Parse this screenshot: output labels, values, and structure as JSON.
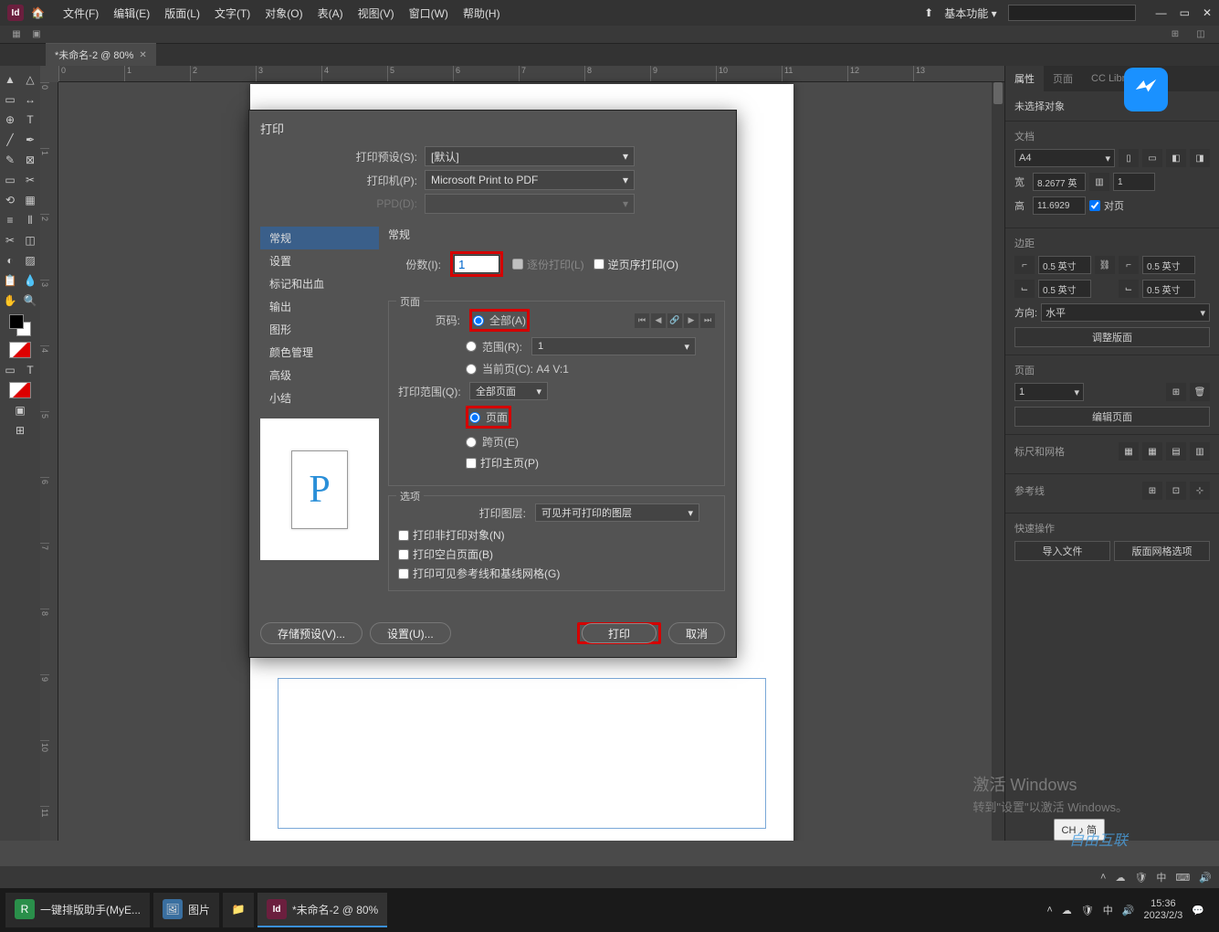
{
  "menubar": {
    "app": "Id",
    "items": [
      "文件(F)",
      "编辑(E)",
      "版面(L)",
      "文字(T)",
      "对象(O)",
      "表(A)",
      "视图(V)",
      "窗口(W)",
      "帮助(H)"
    ],
    "workspace": "基本功能"
  },
  "tab": {
    "name": "*未命名-2 @ 80%"
  },
  "ruler": {
    "ticks": [
      "0",
      "1",
      "2",
      "3",
      "4",
      "5",
      "6",
      "7",
      "8",
      "9",
      "10",
      "11",
      "12",
      "13"
    ]
  },
  "rightpanel": {
    "tabs": [
      "属性",
      "页面",
      "CC Libraries"
    ],
    "noSelection": "未选择对象",
    "doc": {
      "title": "文档",
      "preset": "A4",
      "wLabel": "宽",
      "w": "8.2677 英",
      "hLabel": "高",
      "h": "11.6929",
      "numPages": "1",
      "facingPages": "对页"
    },
    "margins": {
      "title": "边距",
      "top": "0.5 英寸",
      "bottom": "0.5 英寸",
      "left": "0.5 英寸",
      "right": "0.5 英寸"
    },
    "orientation": {
      "label": "方向:",
      "value": "水平"
    },
    "adjustLayout": "调整版面",
    "page": {
      "title": "页面",
      "num": "1",
      "editBtn": "编辑页面"
    },
    "rulers": {
      "title": "标尺和网格"
    },
    "guides": {
      "title": "参考线"
    },
    "quick": {
      "title": "快速操作",
      "import": "导入文件",
      "grid": "版面网格选项"
    }
  },
  "dialog": {
    "title": "打印",
    "preset": {
      "label": "打印预设(S):",
      "value": "[默认]"
    },
    "printer": {
      "label": "打印机(P):",
      "value": "Microsoft Print to PDF"
    },
    "ppd": {
      "label": "PPD(D):"
    },
    "sidebar": [
      "常规",
      "设置",
      "标记和出血",
      "输出",
      "图形",
      "颜色管理",
      "高级",
      "小结"
    ],
    "content": {
      "title": "常规",
      "copies": {
        "label": "份数(I):",
        "value": "1",
        "collate": "逐份打印(L)",
        "reverse": "逆页序打印(O)"
      },
      "pagesGroup": {
        "title": "页面",
        "pageNumLabel": "页码:",
        "all": "全部(A)",
        "rangeLabel": "范围(R):",
        "rangeValue": "1",
        "current": "当前页(C):   A4 V:1",
        "printRangeLabel": "打印范围(Q):",
        "printRangeValue": "全部页面",
        "pagesRadio": "页面",
        "spreads": "跨页(E)",
        "masterPages": "打印主页(P)"
      },
      "optionsGroup": {
        "title": "选项",
        "layersLabel": "打印图层:",
        "layersValue": "可见并可打印的图层",
        "nonPrinting": "打印非打印对象(N)",
        "blankPages": "打印空白页面(B)",
        "guides": "打印可见参考线和基线网格(G)"
      }
    },
    "footer": {
      "savePreset": "存储预设(V)...",
      "setup": "设置(U)...",
      "print": "打印",
      "cancel": "取消"
    }
  },
  "activate": {
    "title": "激活 Windows",
    "sub": "转到\"设置\"以激活 Windows。"
  },
  "chTip": "CH ♪ 简",
  "wm": "自由互联",
  "taskbar": {
    "items": [
      {
        "label": "一键排版助手(MyE...",
        "icon": "R",
        "color": "#2a8f4a"
      },
      {
        "label": "图片",
        "icon": "🖼",
        "color": "#3a6fa0"
      },
      {
        "label": "",
        "icon": "📁",
        "color": "#d8a030"
      },
      {
        "label": "*未命名-2 @ 80%",
        "icon": "Id",
        "color": "#6b1f3e",
        "active": true
      }
    ],
    "time": "15:36",
    "date": "2023/2/3",
    "ime": "中"
  }
}
